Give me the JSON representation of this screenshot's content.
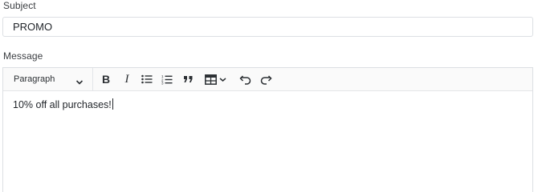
{
  "form": {
    "subject_label": "Subject",
    "subject_value": "PROMO",
    "message_label": "Message"
  },
  "toolbar": {
    "heading_selected": "Paragraph",
    "buttons": [
      "bold-icon",
      "italic-icon",
      "bulleted-list-icon",
      "numbered-list-icon",
      "block-quote-icon",
      "insert-table-icon",
      "undo-icon",
      "redo-icon"
    ]
  },
  "editor": {
    "content": "10% off all purchases!"
  },
  "colors": {
    "border": "#dcdfe3",
    "toolbar_bg": "#fafafa",
    "text": "#1f2328"
  }
}
